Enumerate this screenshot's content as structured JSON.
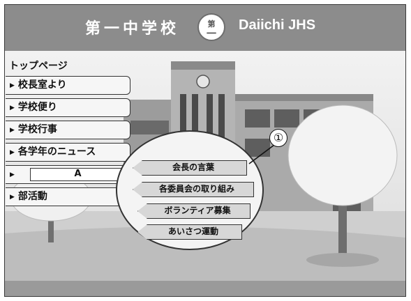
{
  "header": {
    "title_jp": "第一中学校",
    "emblem_top": "第",
    "emblem_bottom": "一",
    "title_en": "Daiichi JHS"
  },
  "nav": {
    "top_link": "トップページ",
    "items": [
      {
        "label": "校長室より"
      },
      {
        "label": "学校便り"
      },
      {
        "label": "学校行事"
      },
      {
        "label": "各学年のニュース"
      },
      {
        "label": "A"
      },
      {
        "label": "部活動"
      }
    ]
  },
  "submenu": {
    "items": [
      {
        "label": "会長の言葉"
      },
      {
        "label": "各委員会の取り組み"
      },
      {
        "label": "ボランティア募集"
      },
      {
        "label": "あいさつ運動"
      }
    ]
  },
  "callout_marker": "①",
  "icons": {
    "arrow": "triangle-right-icon"
  },
  "colors": {
    "header_bg": "#8c8c8c",
    "menu_bg": "#f6f6f6",
    "submenu_bg": "#d7d7d7"
  }
}
